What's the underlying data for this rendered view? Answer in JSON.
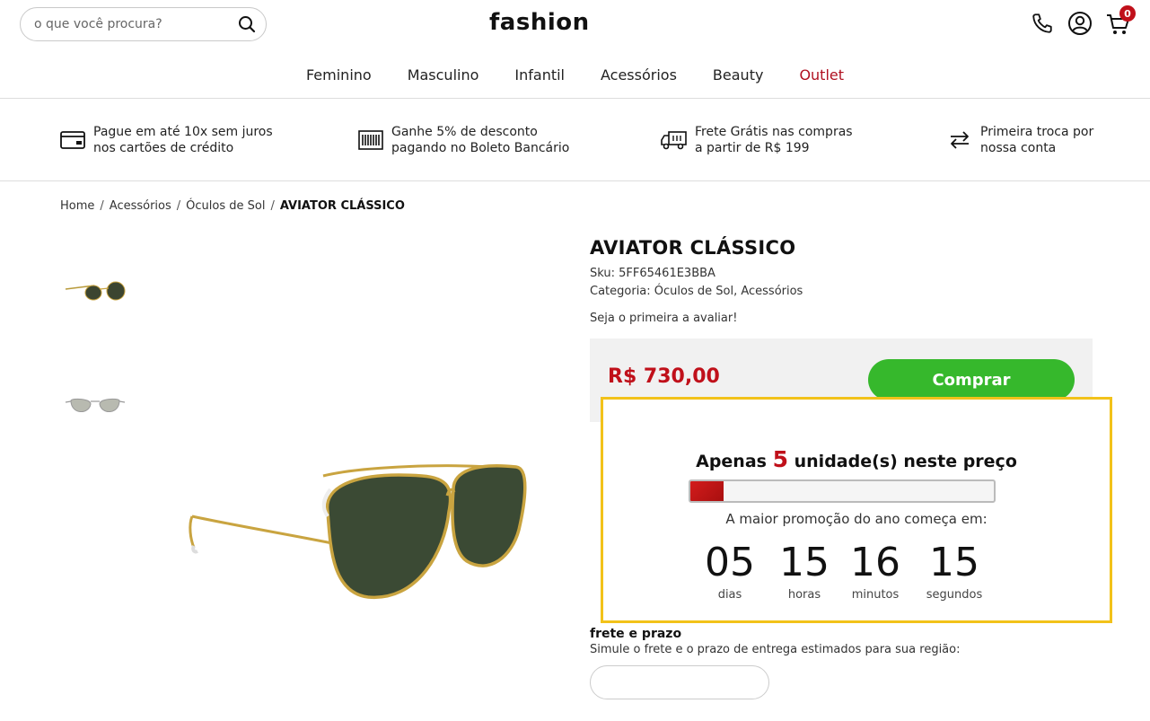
{
  "header": {
    "search_placeholder": "o que você procura?",
    "logo": "fashion",
    "cart_count": "0"
  },
  "nav": {
    "items": [
      "Feminino",
      "Masculino",
      "Infantil",
      "Acessórios",
      "Beauty",
      "Outlet"
    ]
  },
  "benefits": [
    {
      "line1": "Pague em até 10x sem juros",
      "line2": "nos cartões de crédito",
      "icon": "credit-card-icon"
    },
    {
      "line1": "Ganhe 5% de desconto",
      "line2": "pagando no Boleto Bancário",
      "icon": "barcode-icon"
    },
    {
      "line1": "Frete Grátis nas compras",
      "line2": "a partir de R$ 199",
      "icon": "truck-icon"
    },
    {
      "line1": "Primeira troca por",
      "line2": "nossa conta",
      "icon": "exchange-icon"
    }
  ],
  "breadcrumb": {
    "items": [
      "Home",
      "Acessórios",
      "Óculos de Sol"
    ],
    "current": "AVIATOR CLÁSSICO"
  },
  "product": {
    "title": "AVIATOR CLÁSSICO",
    "sku": "Sku: 5FF65461E3BBA",
    "category": "Categoria: Óculos de Sol,  Acessórios",
    "review_text": "Seja o primeira a avaliar!",
    "price": "R$ 730,00",
    "buy_label": "Comprar"
  },
  "promo": {
    "prefix": "Apenas",
    "units": "5",
    "suffix": "unidade(s) neste preço",
    "stock_fraction": 0.11,
    "subtitle": "A maior promoção do ano começa em:",
    "countdown": [
      {
        "value": "05",
        "label": "dias"
      },
      {
        "value": "15",
        "label": "horas"
      },
      {
        "value": "16",
        "label": "minutos"
      },
      {
        "value": "15",
        "label": "segundos"
      }
    ],
    "border_color": "#f2c21a"
  },
  "shipping": {
    "title": "frete e prazo",
    "description": "Simule o frete e o prazo de entrega estimados para sua região:"
  },
  "colors": {
    "accent_red": "#c0101a",
    "buy_green": "#36b82c"
  }
}
